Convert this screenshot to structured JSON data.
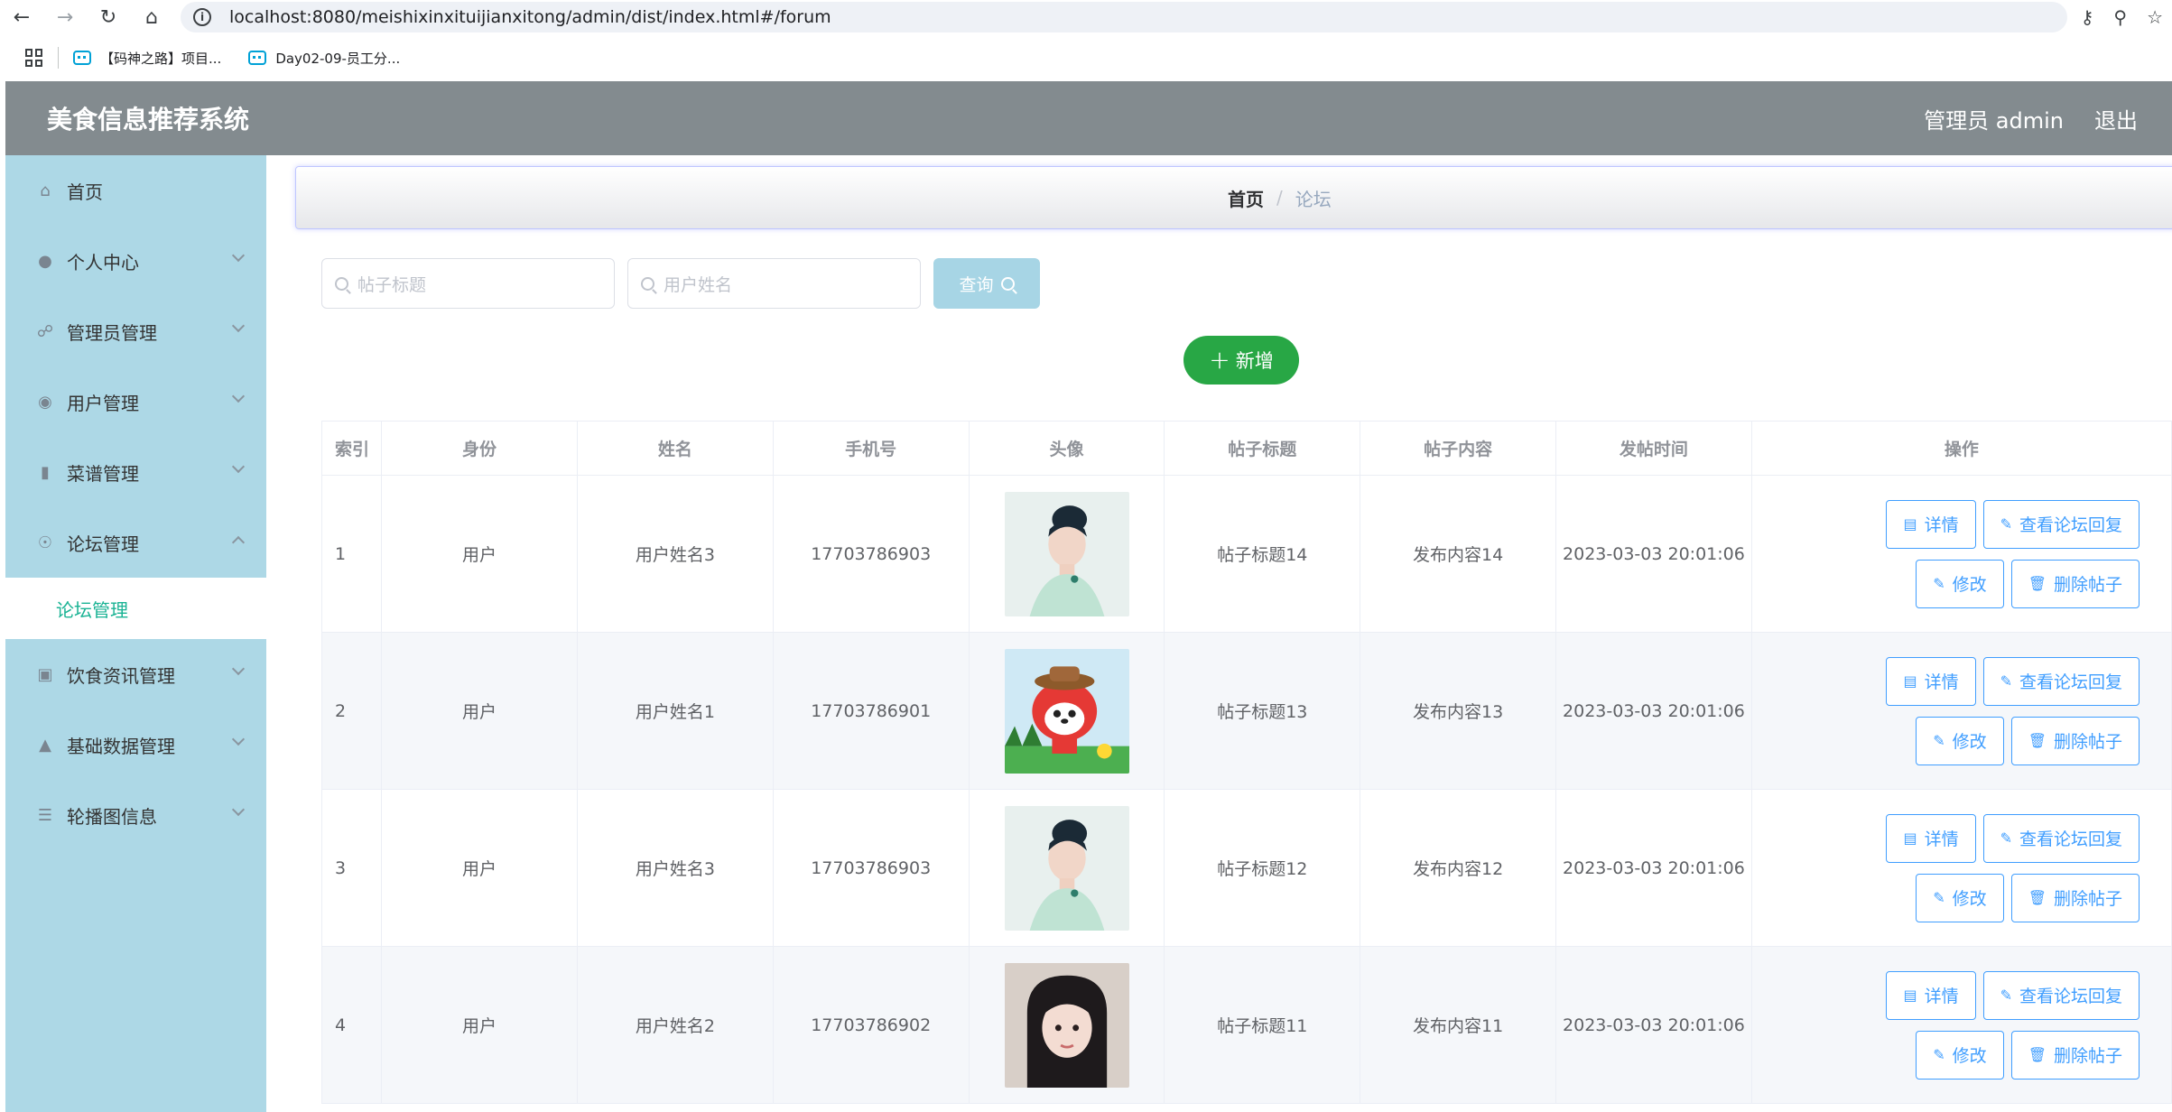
{
  "browser": {
    "url": "localhost:8080/meishixinxituijianxitong/admin/dist/index.html#/forum",
    "bookmarks": [
      "【码神之路】项目...",
      "Day02-09-员工分..."
    ]
  },
  "header": {
    "title": "美食信息推荐系统",
    "user": "管理员 admin",
    "logout": "退出"
  },
  "sidebar": {
    "items": [
      {
        "label": "首页",
        "icon": "home-icon"
      },
      {
        "label": "个人中心",
        "icon": "person-icon"
      },
      {
        "label": "管理员管理",
        "icon": "bell-off-icon"
      },
      {
        "label": "用户管理",
        "icon": "pin-icon"
      },
      {
        "label": "菜谱管理",
        "icon": "ticket-icon"
      },
      {
        "label": "论坛管理",
        "icon": "compass-icon"
      },
      {
        "label": "饮食资讯管理",
        "icon": "frame-icon"
      },
      {
        "label": "基础数据管理",
        "icon": "stamp-icon"
      },
      {
        "label": "轮播图信息",
        "icon": "list-icon"
      }
    ],
    "active_sub": "论坛管理"
  },
  "breadcrumb": {
    "home": "首页",
    "separator": "/",
    "current": "论坛"
  },
  "search": {
    "title_placeholder": "帖子标题",
    "name_placeholder": "用户姓名",
    "query_label": "查询"
  },
  "add_label": "新增",
  "table": {
    "headers": [
      "索引",
      "身份",
      "姓名",
      "手机号",
      "头像",
      "帖子标题",
      "帖子内容",
      "发帖时间",
      "操作"
    ],
    "rows": [
      {
        "index": "1",
        "role": "用户",
        "name": "用户姓名3",
        "phone": "17703786903",
        "avatar": "woman-updo",
        "title": "帖子标题14",
        "content": "发布内容14",
        "time": "2023-03-03 20:01:06"
      },
      {
        "index": "2",
        "role": "用户",
        "name": "用户姓名1",
        "phone": "17703786901",
        "avatar": "cartoon-fox",
        "title": "帖子标题13",
        "content": "发布内容13",
        "time": "2023-03-03 20:01:06"
      },
      {
        "index": "3",
        "role": "用户",
        "name": "用户姓名3",
        "phone": "17703786903",
        "avatar": "woman-updo",
        "title": "帖子标题12",
        "content": "发布内容12",
        "time": "2023-03-03 20:01:06"
      },
      {
        "index": "4",
        "role": "用户",
        "name": "用户姓名2",
        "phone": "17703786902",
        "avatar": "girl-bangs",
        "title": "帖子标题11",
        "content": "发布内容11",
        "time": "2023-03-03 20:01:06"
      }
    ],
    "ops": {
      "detail": "详情",
      "replies": "查看论坛回复",
      "edit": "修改",
      "delete": "删除帖子"
    }
  },
  "colors": {
    "header_bg": "#838b8f",
    "sidebar_bg": "#add8e6",
    "active_text": "#1ab394",
    "add_button": "#28a745",
    "primary": "#409eff"
  }
}
